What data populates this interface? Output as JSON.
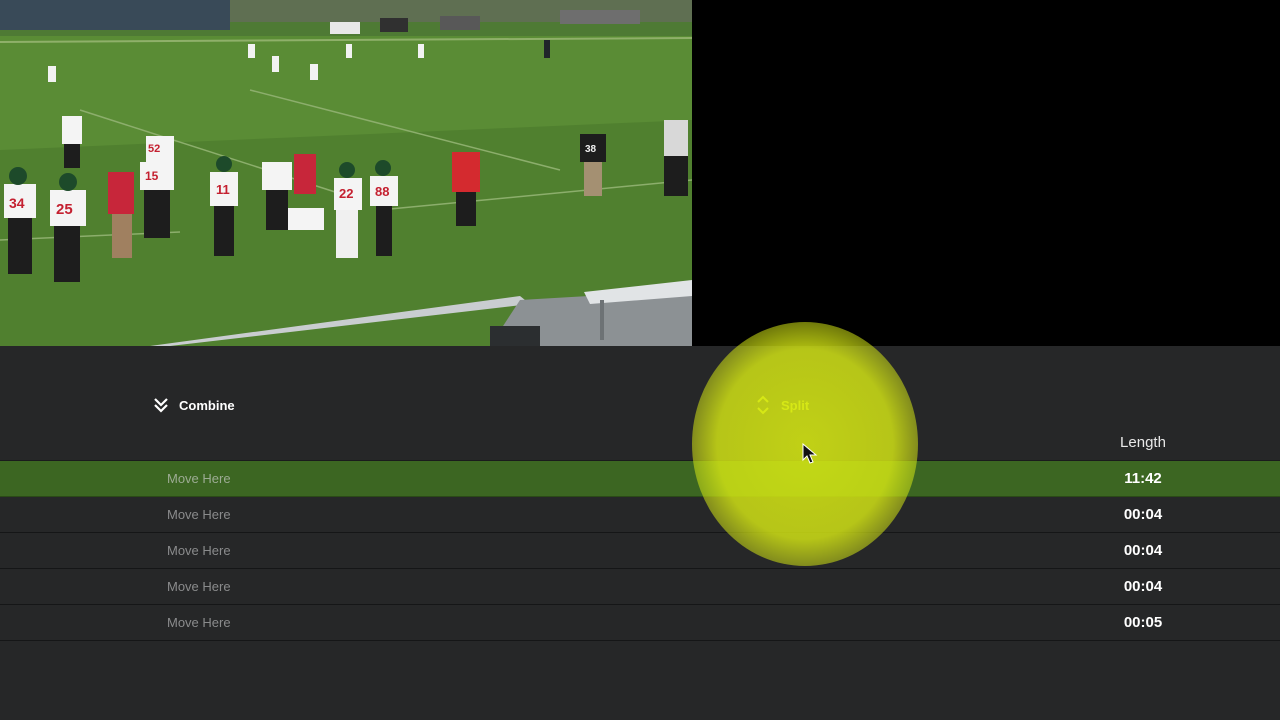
{
  "toolbar": {
    "combine_label": "Combine",
    "combine_icon": "double-chevron-down-icon",
    "split_label": "Split",
    "split_icon": "expand-vertical-icon"
  },
  "table": {
    "length_header": "Length",
    "rows": [
      {
        "move_label": "Move Here",
        "length": "11:42",
        "selected": true
      },
      {
        "move_label": "Move Here",
        "length": "00:04",
        "selected": false
      },
      {
        "move_label": "Move Here",
        "length": "00:04",
        "selected": false
      },
      {
        "move_label": "Move Here",
        "length": "00:04",
        "selected": false
      },
      {
        "move_label": "Move Here",
        "length": "00:05",
        "selected": false
      }
    ]
  },
  "video": {
    "jersey_numbers": [
      "34",
      "25",
      "52",
      "15",
      "11",
      "22",
      "88",
      "38"
    ]
  },
  "colors": {
    "accent": "#d8e61a",
    "selected_row": "#3c6622",
    "panel_background": "#262728"
  }
}
